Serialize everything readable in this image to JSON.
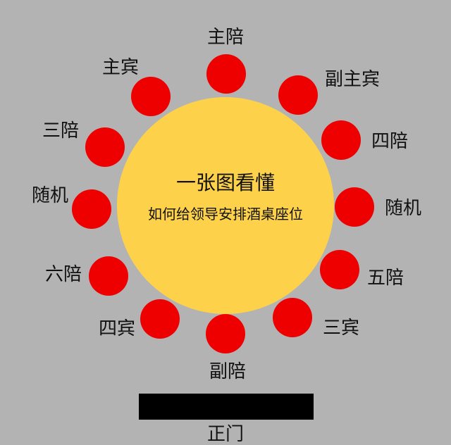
{
  "colors": {
    "background": "#b3b3b3",
    "table": "#fdd24a",
    "seat": "#ee0000",
    "door": "#000000"
  },
  "table": {
    "title": "一张图看懂",
    "subtitle": "如何给领导安排酒桌座位"
  },
  "seats": [
    {
      "label": "主陪"
    },
    {
      "label": "副主宾"
    },
    {
      "label": "四陪"
    },
    {
      "label": "随机"
    },
    {
      "label": "五陪"
    },
    {
      "label": "三宾"
    },
    {
      "label": "副陪"
    },
    {
      "label": "四宾"
    },
    {
      "label": "六陪"
    },
    {
      "label": "随机"
    },
    {
      "label": "三陪"
    },
    {
      "label": "主宾"
    }
  ],
  "door": {
    "label": "正门"
  }
}
